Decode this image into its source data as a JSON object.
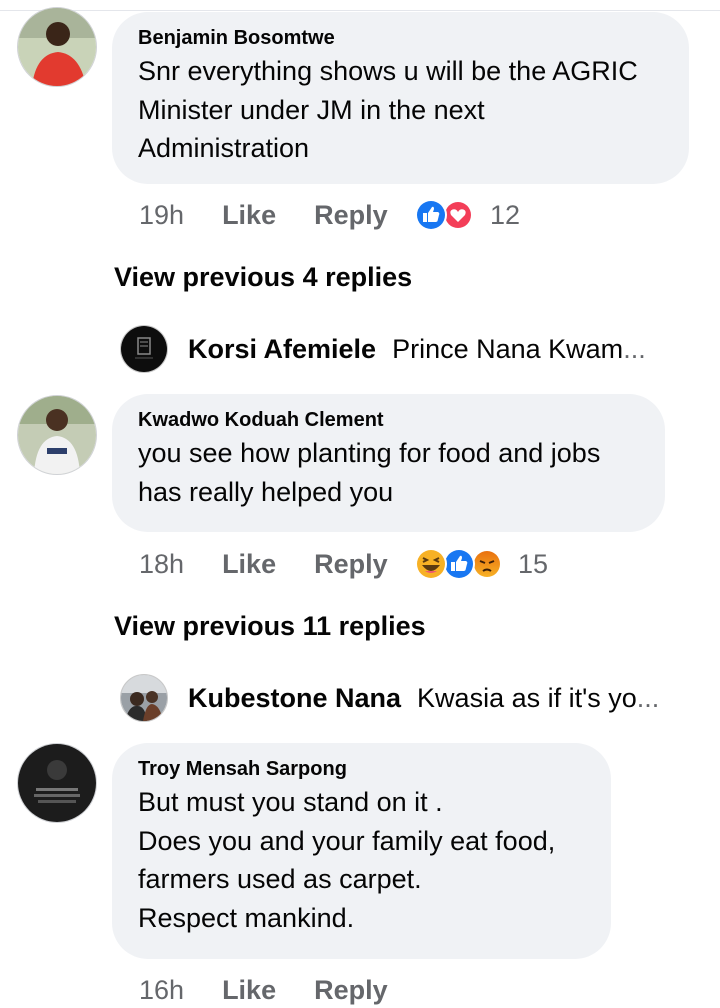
{
  "comments": [
    {
      "author": "Benjamin Bosomtwe",
      "text": "Snr everything shows u will be the AGRIC\nMinister under JM in the next\nAdministration",
      "time": "19h",
      "like": "Like",
      "reply": "Reply",
      "reaction_count": "12",
      "reactions": [
        "like-icon",
        "love-icon"
      ]
    },
    {
      "author": "Kwadwo Koduah Clement",
      "text": "you see how planting for food and jobs\nhas really helped you",
      "time": "18h",
      "like": "Like",
      "reply": "Reply",
      "reaction_count": "15",
      "reactions": [
        "haha-icon",
        "like-icon",
        "angry-icon"
      ]
    },
    {
      "author": "Troy Mensah Sarpong",
      "text": "But must you stand on it .\nDoes you and your family eat food,\nfarmers used as carpet.\nRespect mankind.",
      "time": "16h",
      "like": "Like",
      "reply": "Reply"
    }
  ],
  "thread1": {
    "view_previous": "View previous 4 replies",
    "reply_name": "Korsi Afemiele",
    "reply_text": "Prince Nana Kwam",
    "ellipsis": "..."
  },
  "thread2": {
    "view_previous": "View previous 11 replies",
    "reply_name": "Kubestone Nana",
    "reply_text": "Kwasia as if it's yo",
    "ellipsis": "..."
  },
  "colors": {
    "bubble": "#f0f2f5",
    "meta_text": "#65676b",
    "like_blue": "#1877f2",
    "love_red": "#f33e58",
    "haha_yellow": "#f7b125"
  }
}
